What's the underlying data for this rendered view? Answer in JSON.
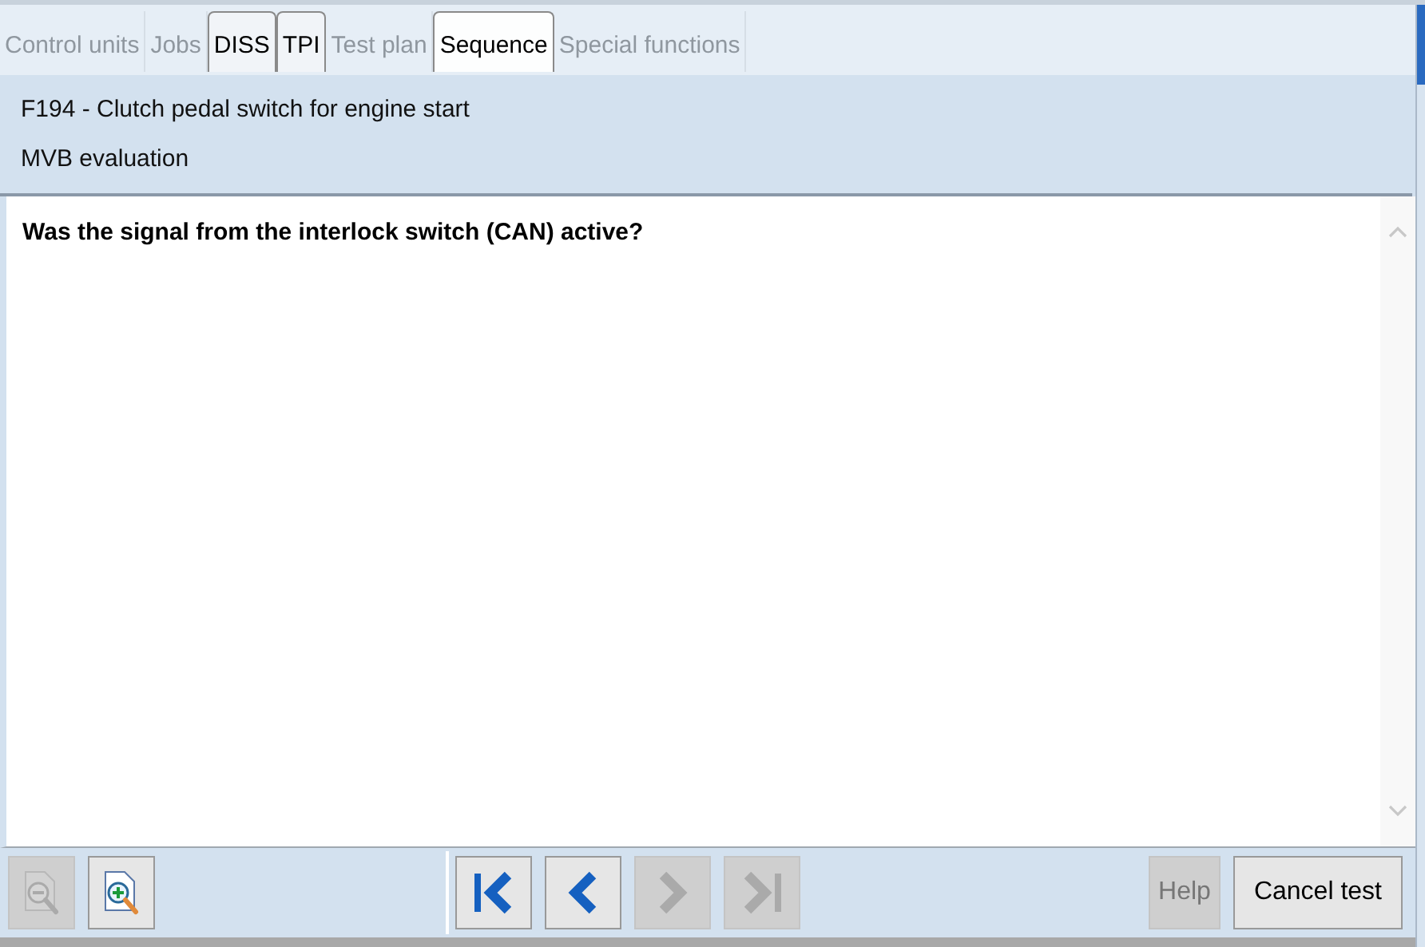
{
  "tabs": [
    {
      "label": "Control units",
      "disabled": true,
      "selected": false
    },
    {
      "label": "Jobs",
      "disabled": true,
      "selected": false
    },
    {
      "label": "DISS",
      "disabled": false,
      "selected": false
    },
    {
      "label": "TPI",
      "disabled": false,
      "selected": false
    },
    {
      "label": "Test plan",
      "disabled": true,
      "selected": false
    },
    {
      "label": "Sequence",
      "disabled": false,
      "selected": true
    },
    {
      "label": "Special functions",
      "disabled": true,
      "selected": false
    }
  ],
  "header": {
    "title": "F194 - Clutch pedal switch for engine start",
    "subtitle": "MVB evaluation"
  },
  "question": "Was the signal from the interlock switch (CAN) active?",
  "zoom_buttons": [
    {
      "kind": "zoom-out",
      "disabled": true
    },
    {
      "kind": "zoom-in",
      "disabled": false
    }
  ],
  "nav_buttons": [
    {
      "kind": "first",
      "disabled": false
    },
    {
      "kind": "previous",
      "disabled": false
    },
    {
      "kind": "next",
      "disabled": true
    },
    {
      "kind": "last",
      "disabled": true
    }
  ],
  "action_buttons": [
    {
      "label": "Help",
      "disabled": true
    },
    {
      "label": "Cancel test",
      "disabled": false
    }
  ]
}
